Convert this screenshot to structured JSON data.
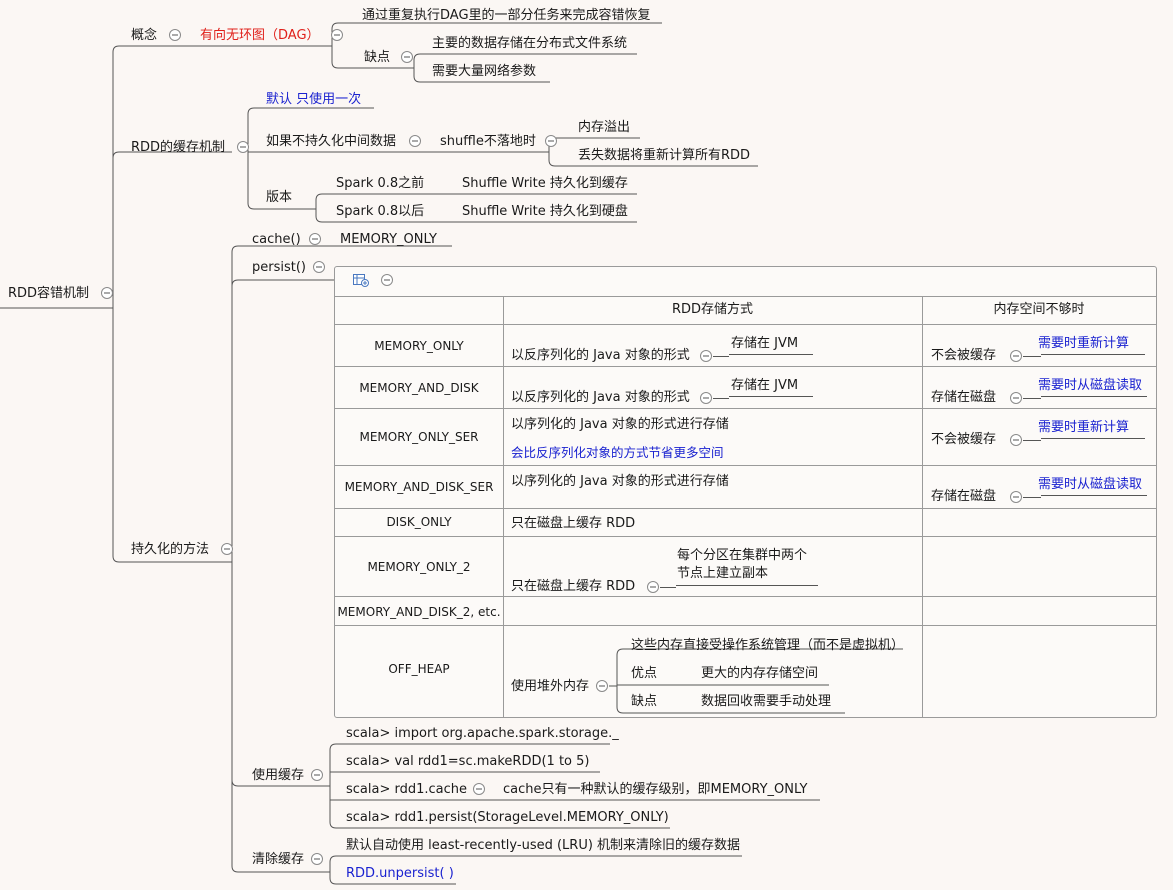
{
  "root": "RDD容错机制",
  "branches": {
    "concept": {
      "label": "概念",
      "dag": "有向无环图（DAG）",
      "dag_children": {
        "recover": "通过重复执行DAG里的一部分任务来完成容错恢复",
        "drawback_label": "缺点",
        "drawbacks": [
          "主要的数据存储在分布式文件系统",
          "需要大量网络参数"
        ]
      }
    },
    "cache_mech": {
      "label": "RDD的缓存机制",
      "default": "默认 只使用一次",
      "no_persist": "如果不持久化中间数据",
      "shuffle": "shuffle不落地时",
      "shuffle_results": [
        "内存溢出",
        "丢失数据将重新计算所有RDD"
      ],
      "version_label": "版本",
      "versions": [
        {
          "name": "Spark 0.8之前",
          "desc": "Shuffle Write 持久化到缓存"
        },
        {
          "name": "Spark 0.8以后",
          "desc": "Shuffle Write 持久化到硬盘"
        }
      ]
    },
    "persist": {
      "label": "持久化的方法",
      "cache_fn": "cache()",
      "cache_level": "MEMORY_ONLY",
      "persist_fn": "persist()",
      "table": {
        "headers": [
          "RDD存储方式",
          "内存空间不够时"
        ],
        "rows": [
          {
            "level": "MEMORY_ONLY",
            "storage": "以反序列化的 Java 对象的形式",
            "storage_note": "存储在 JVM",
            "oom": "不会被缓存",
            "oom_note": "需要时重新计算"
          },
          {
            "level": "MEMORY_AND_DISK",
            "storage": "以反序列化的 Java 对象的形式",
            "storage_note": "存储在 JVM",
            "oom": "存储在磁盘",
            "oom_note": "需要时从磁盘读取"
          },
          {
            "level": "MEMORY_ONLY_SER",
            "storage": "以序列化的 Java 对象的形式进行存储",
            "storage_note2": "会比反序列化对象的方式节省更多空间",
            "oom": "不会被缓存",
            "oom_note": "需要时重新计算"
          },
          {
            "level": "MEMORY_AND_DISK_SER",
            "storage": "以序列化的 Java 对象的形式进行存储",
            "oom": "存储在磁盘",
            "oom_note": "需要时从磁盘读取"
          },
          {
            "level": "DISK_ONLY",
            "storage": "只在磁盘上缓存 RDD"
          },
          {
            "level": "MEMORY_ONLY_2",
            "storage": "只在磁盘上缓存 RDD",
            "storage_note": "每个分区在集群中两个节点上建立副本",
            "storage_note_l1": "每个分区在集群中两个",
            "storage_note_l2": "节点上建立副本"
          },
          {
            "level": "MEMORY_AND_DISK_2, etc."
          },
          {
            "level": "OFF_HEAP",
            "storage": "使用堆外内存",
            "offheap_managed": "这些内存直接受操作系统管理（而不是虚拟机）",
            "pro_label": "优点",
            "pro": "更大的内存存储空间",
            "con_label": "缺点",
            "con": "数据回收需要手动处理"
          }
        ]
      },
      "use_cache": {
        "label": "使用缓存",
        "lines": [
          "scala> import org.apache.spark.storage._",
          "scala> val rdd1=sc.makeRDD(1 to 5)",
          "scala> rdd1.cache",
          "scala> rdd1.persist(StorageLevel.MEMORY_ONLY)"
        ],
        "cache_note": "cache只有一种默认的缓存级别，即MEMORY_ONLY"
      },
      "clear_cache": {
        "label": "清除缓存",
        "lru": "默认自动使用 least-recently-used (LRU) 机制来清除旧的缓存数据",
        "unpersist": "RDD.unpersist( )"
      }
    }
  },
  "colors": {
    "line": "#555555",
    "blue": "#1a22d0",
    "red": "#e0201a",
    "table_border": "#9a9a9a"
  }
}
